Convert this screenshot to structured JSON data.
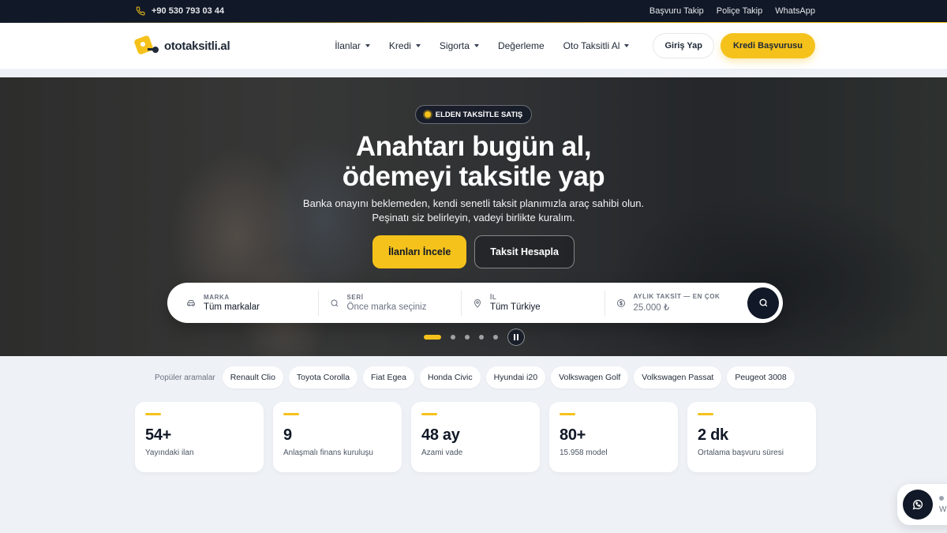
{
  "topbar": {
    "phone": "+90 530 793 03 44",
    "links": [
      "Başvuru Takip",
      "Poliçe Takip",
      "WhatsApp"
    ]
  },
  "header": {
    "logo_text": "ototaksitli.al",
    "nav": [
      {
        "label": "İlanlar",
        "dropdown": true
      },
      {
        "label": "Kredi",
        "dropdown": true
      },
      {
        "label": "Sigorta",
        "dropdown": true
      },
      {
        "label": "Değerleme",
        "dropdown": false
      },
      {
        "label": "Oto Taksitli Al",
        "dropdown": true
      }
    ],
    "login_label": "Giriş Yap",
    "credit_label": "Kredi Başvurusu"
  },
  "hero": {
    "badge": "ELDEN TAKSİTLE SATIŞ",
    "title_line1": "Anahtarı bugün al,",
    "title_line2": "ödemeyi taksitle yap",
    "subtitle_line1": "Banka onayını beklemeden, kendi senetli taksit planımızla araç sahibi olun.",
    "subtitle_line2": "Peşinatı siz belirleyin, vadeyi birlikte kuralım.",
    "primary_btn": "İlanları İncele",
    "secondary_btn": "Taksit Hesapla",
    "slides_total": 5,
    "slide_active": 1
  },
  "search": {
    "fields": [
      {
        "label": "MARKA",
        "value": "Tüm markalar",
        "icon": "car-icon"
      },
      {
        "label": "SERİ",
        "value": "Önce marka seçiniz",
        "icon": "search-icon"
      },
      {
        "label": "İL",
        "value": "Tüm Türkiye",
        "icon": "location-pin-icon"
      },
      {
        "label": "AYLIK TAKSİT — EN ÇOK",
        "value": "25.000 ₺",
        "icon": "currency-icon"
      }
    ]
  },
  "popular": {
    "label": "Popüler aramalar",
    "chips": [
      "Renault Clio",
      "Toyota Corolla",
      "Fiat Egea",
      "Honda Civic",
      "Hyundai i20",
      "Volkswagen Golf",
      "Volkswagen Passat",
      "Peugeot 3008"
    ]
  },
  "stats": [
    {
      "value": "54+",
      "label": "Yayındaki ilan"
    },
    {
      "value": "9",
      "label": "Anlaşmalı finans kuruluşu"
    },
    {
      "value": "48 ay",
      "label": "Azami vade"
    },
    {
      "value": "80+",
      "label": "15.958 model"
    },
    {
      "value": "2 dk",
      "label": "Ortalama başvuru süresi"
    }
  ],
  "whatsapp_widget": {
    "letter": "W"
  },
  "colors": {
    "accent": "#f5c21b",
    "dark": "#111827"
  }
}
